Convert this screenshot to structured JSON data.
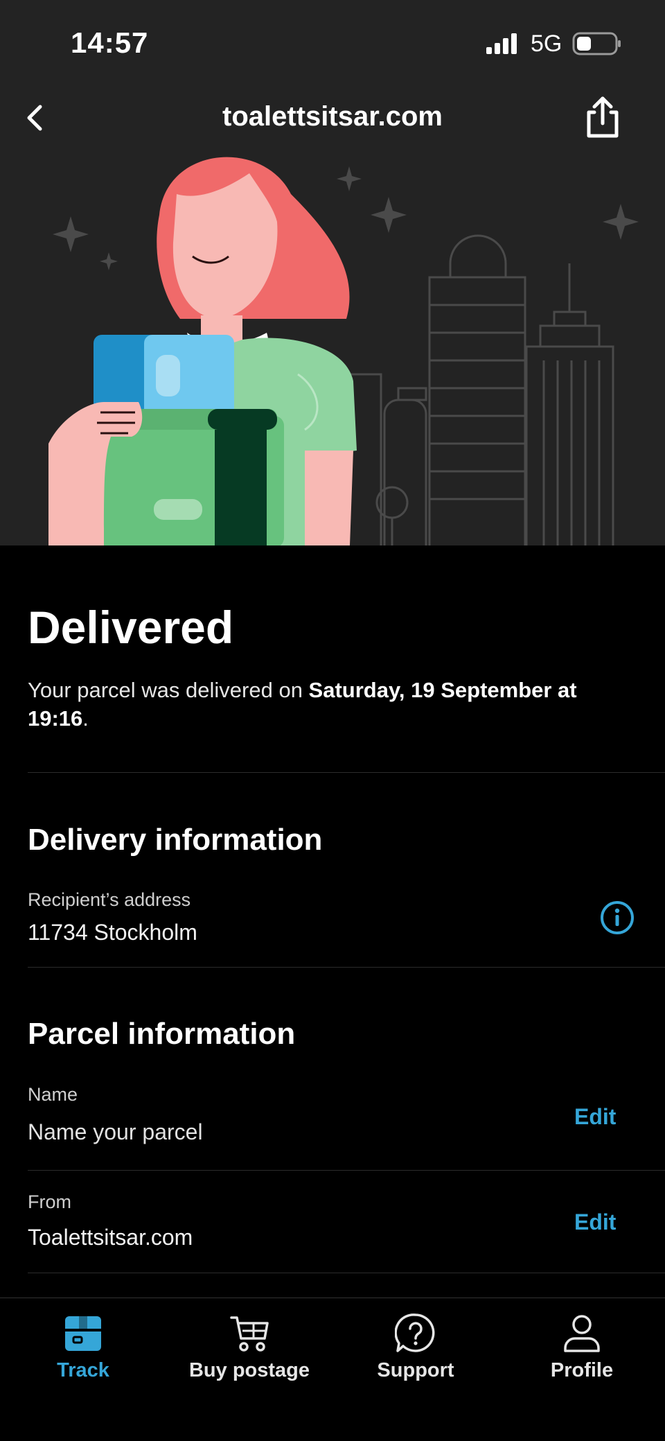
{
  "status_bar": {
    "time": "14:57",
    "network": "5G"
  },
  "nav": {
    "title": "toalettsitsar.com",
    "back_icon": "chevron-left-icon",
    "share_icon": "share-icon"
  },
  "hero": {
    "illustration": "woman-holding-parcels-illustration"
  },
  "delivery_status": {
    "title": "Delivered",
    "desc_prefix": "Your parcel was delivered on ",
    "desc_date": "Saturday, 19 September at 19:16",
    "desc_suffix": "."
  },
  "delivery_info": {
    "title": "Delivery information",
    "label": "Recipient’s address",
    "value": "11734 Stockholm",
    "info_icon": "info-icon"
  },
  "parcel_info": {
    "title": "Parcel information",
    "name_label": "Name",
    "name_placeholder": "Name your parcel",
    "from_label": "From",
    "from_value": "Toalettsitsar.com",
    "edit_label": "Edit"
  },
  "tabs": [
    {
      "label": "Track",
      "icon": "parcel-box-icon",
      "active": true
    },
    {
      "label": "Buy postage",
      "icon": "cart-icon",
      "active": false
    },
    {
      "label": "Support",
      "icon": "question-circle-icon",
      "active": false
    },
    {
      "label": "Profile",
      "icon": "person-icon",
      "active": false
    }
  ],
  "colors": {
    "accent": "#35a6d8",
    "background": "#000000",
    "header_background": "#232323"
  }
}
